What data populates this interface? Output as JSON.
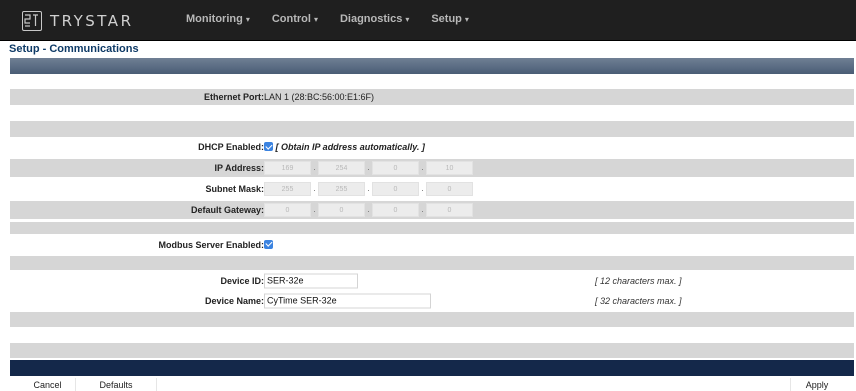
{
  "brand": {
    "name": "TRYSTAR"
  },
  "nav": {
    "items": [
      {
        "label": "Monitoring"
      },
      {
        "label": "Control"
      },
      {
        "label": "Diagnostics"
      },
      {
        "label": "Setup"
      }
    ],
    "caret": "▾"
  },
  "page": {
    "title": "Setup - Communications"
  },
  "ethernet": {
    "label": "Ethernet Port:",
    "value": "LAN 1 (28:BC:56:00:E1:6F)"
  },
  "dhcp": {
    "label": "DHCP Enabled:",
    "checked": true,
    "note": "[ Obtain IP address automatically. ]"
  },
  "ip": {
    "label": "IP Address:",
    "octets": [
      "169",
      "254",
      "0",
      "10"
    ]
  },
  "subnet": {
    "label": "Subnet Mask:",
    "octets": [
      "255",
      "255",
      "0",
      "0"
    ]
  },
  "gateway": {
    "label": "Default Gateway:",
    "octets": [
      "0",
      "0",
      "0",
      "0"
    ]
  },
  "modbus": {
    "label": "Modbus Server Enabled:",
    "checked": true
  },
  "device_id": {
    "label": "Device ID:",
    "value": "SER-32e",
    "hint": "[ 12 characters max. ]"
  },
  "device_name": {
    "label": "Device Name:",
    "value": "CyTime SER-32e",
    "hint": "[ 32 characters max. ]"
  },
  "buttons": {
    "cancel": "Cancel",
    "defaults": "Defaults",
    "apply": "Apply"
  }
}
